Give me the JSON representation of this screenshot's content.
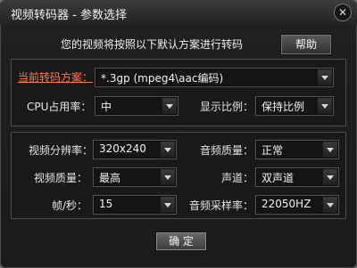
{
  "window": {
    "title": "视频转码器 - 参数选择",
    "close_glyph": "✕",
    "close_icon": "close-icon"
  },
  "intro_text": "您的视频将按照以下默认方案进行转码",
  "help_label": "帮助",
  "scheme": {
    "label": "当前转码方案：",
    "value": "*.3gp (mpeg4\\aac编码)"
  },
  "cpu": {
    "label": "CPU占用率：",
    "value": "中"
  },
  "display_ratio": {
    "label": "显示比例：",
    "value": "保持比例"
  },
  "video_resolution": {
    "label": "视频分辨率：",
    "value": "320x240"
  },
  "audio_quality": {
    "label": "音频质量：",
    "value": "正常"
  },
  "video_quality": {
    "label": "视频质量：",
    "value": "最高"
  },
  "channel": {
    "label": "声道：",
    "value": "双声道"
  },
  "fps": {
    "label": "帧/秒：",
    "value": "15"
  },
  "sample_rate": {
    "label": "音频采样率：",
    "value": "22050HZ"
  },
  "ok_label": "确 定"
}
